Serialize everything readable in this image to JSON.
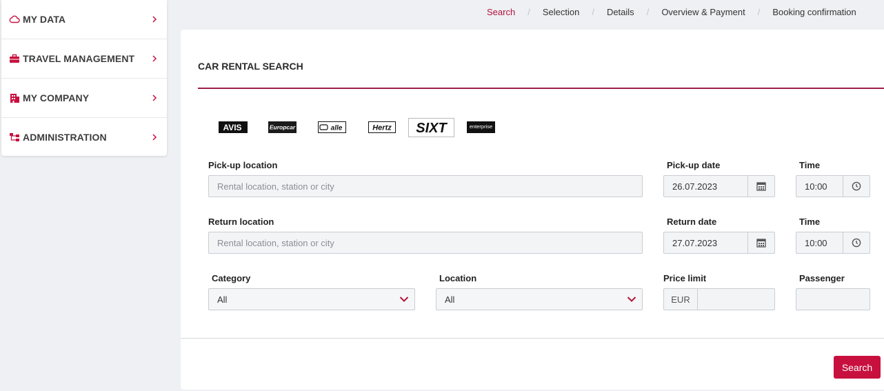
{
  "colors": {
    "accent": "#b3123a",
    "button": "#c8103e",
    "rule": "#9b1f45"
  },
  "sidebar": {
    "items": [
      {
        "label": "MY DATA",
        "icon": "cloud-icon"
      },
      {
        "label": "TRAVEL MANAGEMENT",
        "icon": "briefcase-icon"
      },
      {
        "label": "MY COMPANY",
        "icon": "building-icon"
      },
      {
        "label": "ADMINISTRATION",
        "icon": "sitemap-icon"
      }
    ]
  },
  "breadcrumb": {
    "steps": [
      "Search",
      "Selection",
      "Details",
      "Overview & Payment",
      "Booking confirmation"
    ],
    "active": "Search"
  },
  "page": {
    "title": "CAR RENTAL SEARCH"
  },
  "brands": {
    "avis": "AVIS",
    "europcar": "Europcar",
    "alle": "alle",
    "hertz": "Hertz",
    "sixt": "SIXT",
    "enterprise": "enterprise"
  },
  "form": {
    "pickup_location": {
      "label": "Pick-up location",
      "placeholder": "Rental location, station or city",
      "value": ""
    },
    "pickup_date": {
      "label": "Pick-up date",
      "value": "26.07.2023"
    },
    "pickup_time": {
      "label": "Time",
      "value": "10:00"
    },
    "return_location": {
      "label": "Return location",
      "placeholder": "Rental location, station or city",
      "value": ""
    },
    "return_date": {
      "label": "Return date",
      "value": "27.07.2023"
    },
    "return_time": {
      "label": "Time",
      "value": "10:00"
    },
    "category": {
      "label": "Category",
      "value": "All"
    },
    "location": {
      "label": "Location",
      "value": "All"
    },
    "price_limit": {
      "label": "Price limit",
      "currency": "EUR",
      "value": ""
    },
    "passenger": {
      "label": "Passenger",
      "value": ""
    }
  },
  "actions": {
    "search_label": "Search"
  }
}
